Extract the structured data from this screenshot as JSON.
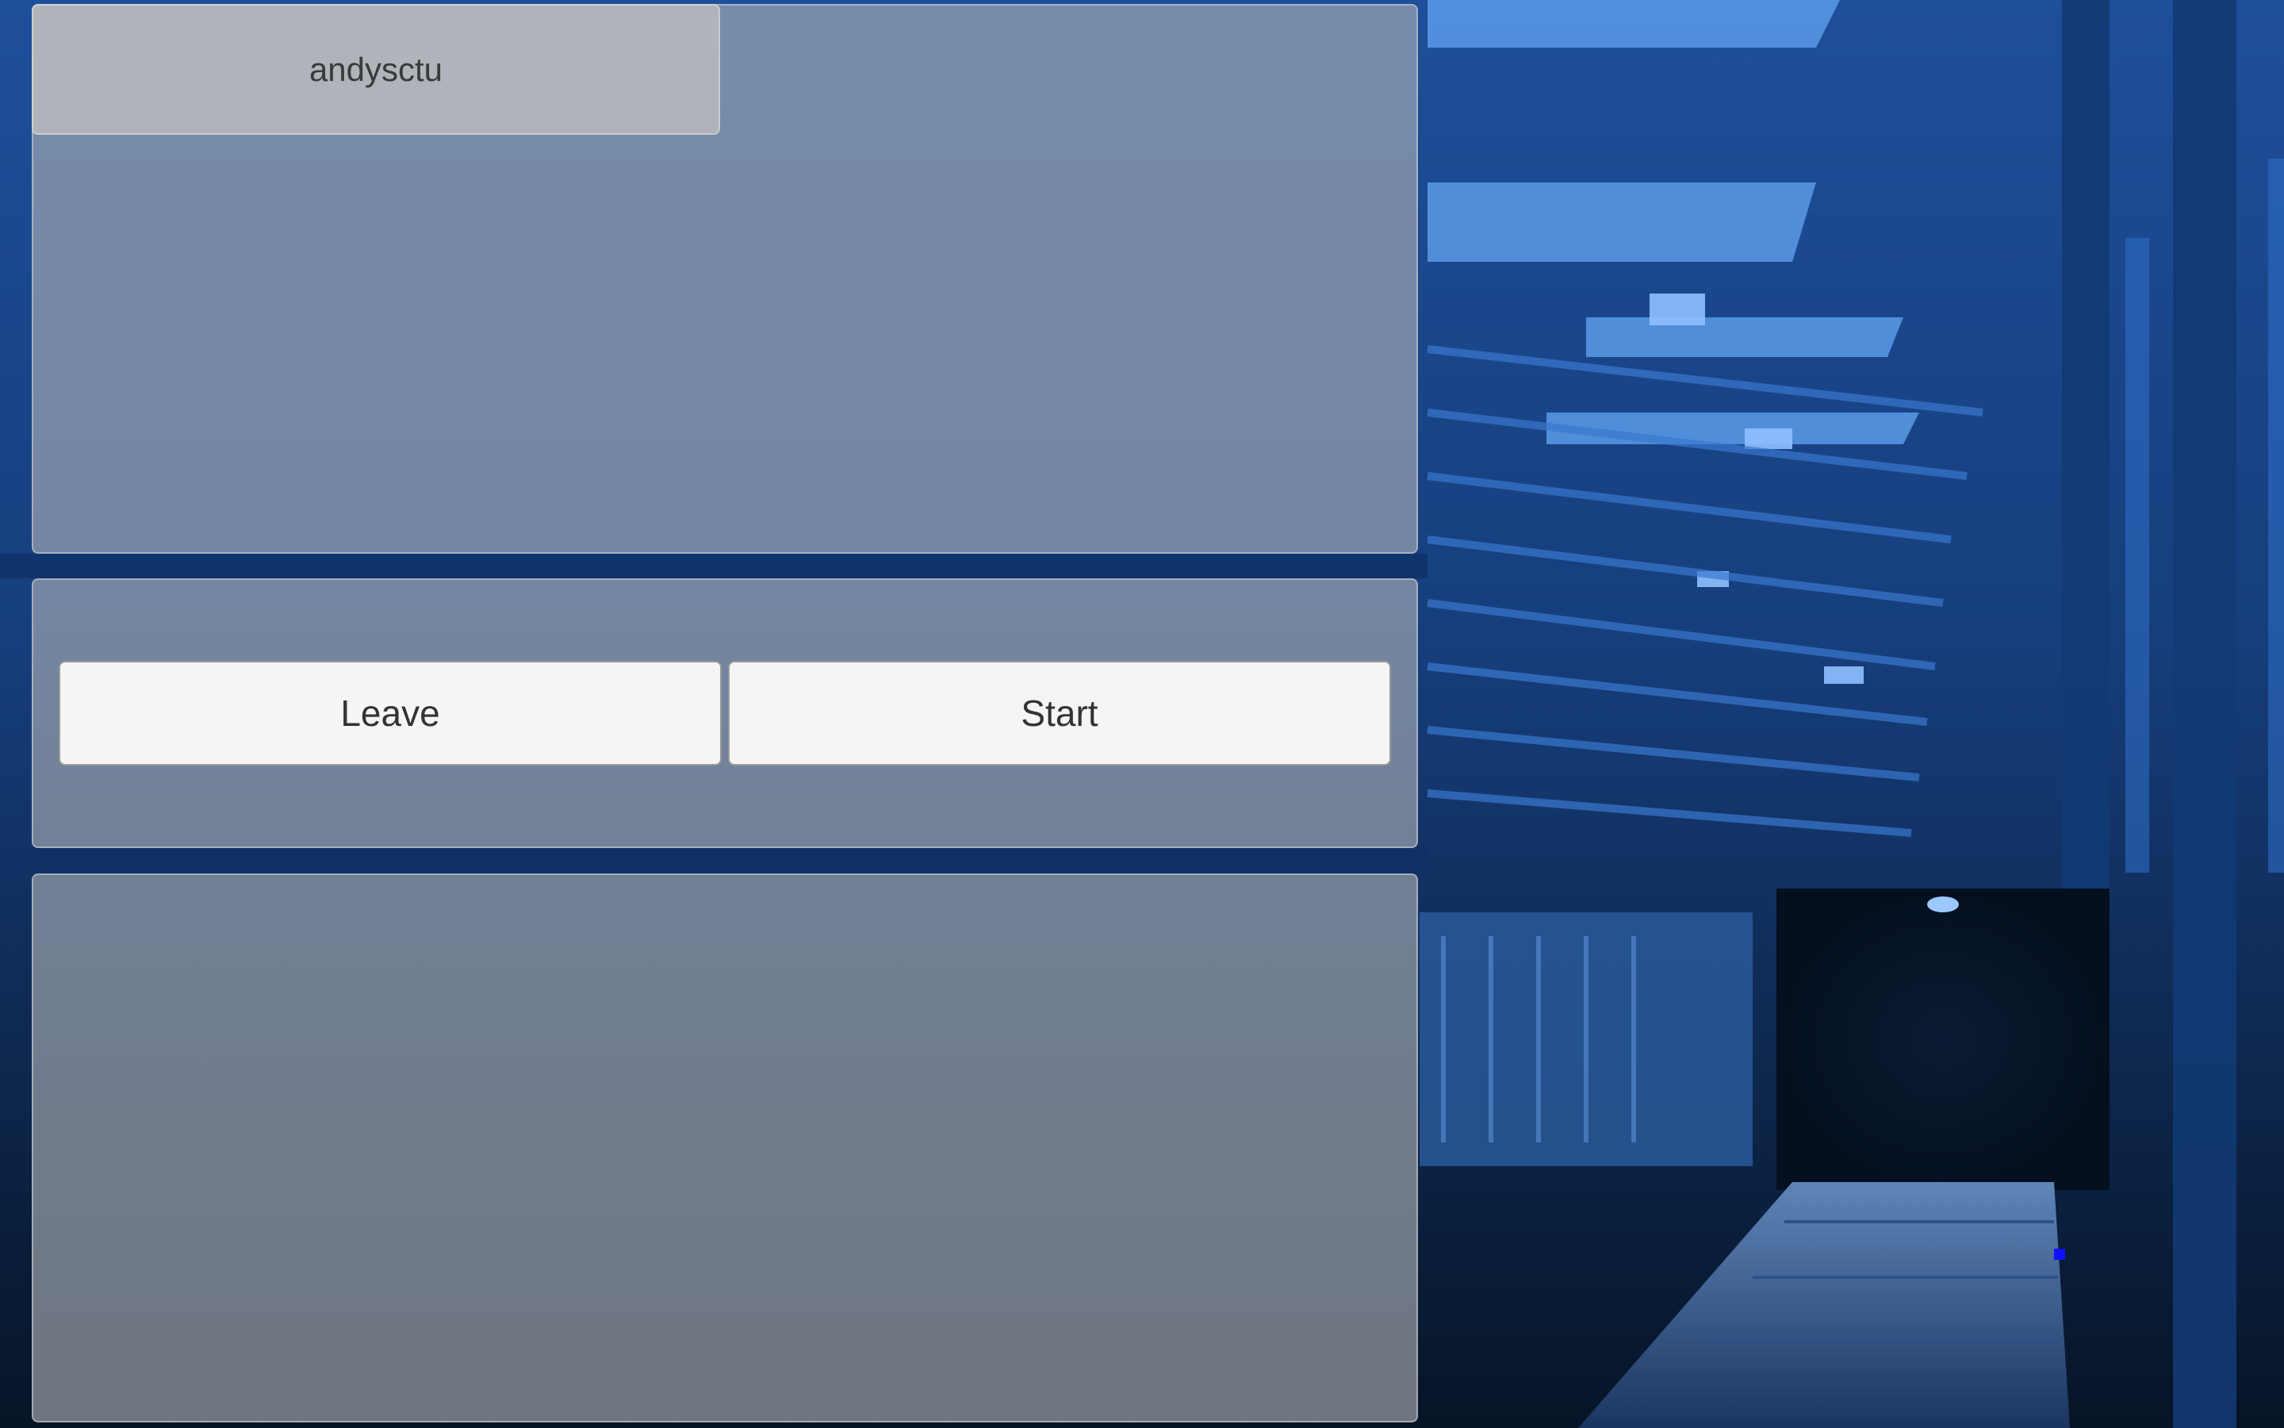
{
  "lobby": {
    "player_name": "andysctu"
  },
  "actions": {
    "leave_label": "Leave",
    "start_label": "Start"
  },
  "theme": {
    "background_scene": "sci-fi corridor",
    "background_tint": "#1f5fb5",
    "panel_color": "#afb2b6",
    "button_color": "#f5f5f5"
  }
}
